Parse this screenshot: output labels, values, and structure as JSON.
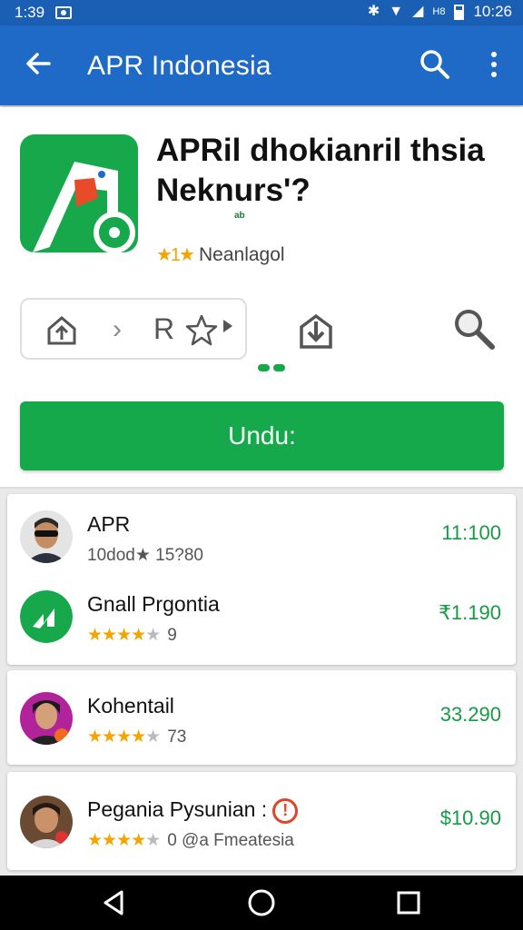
{
  "status_bar": {
    "time_left": "1:39",
    "time": "10:26",
    "signal_text": "H8"
  },
  "app_bar": {
    "title": "APR Indonesia"
  },
  "hero": {
    "app_name": "APRil dhokianril thsia Neknurs'?",
    "sub_label": "ab",
    "rating_stars": "★1★",
    "rating_text": "Neanlagol",
    "action_r_label": "R",
    "install_label": "Undu:"
  },
  "list": [
    {
      "name": "APR",
      "sub_text": "10dod★ 15?80",
      "price": "11:100",
      "avatar": "person-sunglasses",
      "stars": 0
    },
    {
      "name": "Gnall Prgontia",
      "sub_text": "9",
      "price": "₹1.190",
      "avatar": "green-logo",
      "stars": 4
    },
    {
      "name": "Kohentail",
      "sub_text": "73",
      "price": "33.290",
      "avatar": "person-magenta",
      "stars": 4
    },
    {
      "name": "Pegania Pysunian :",
      "sub_text": "0  @a Fmeatesia",
      "price": "$10.90",
      "avatar": "person-brown",
      "stars": 4
    }
  ],
  "colors": {
    "appbar": "#1e6ac6",
    "accent_green": "#15a94b",
    "star": "#f4a400"
  }
}
